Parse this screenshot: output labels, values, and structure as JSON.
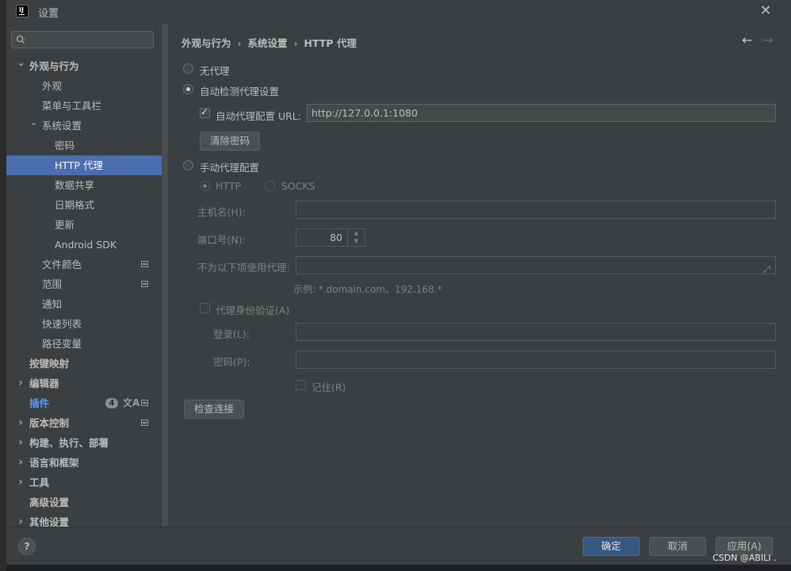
{
  "window": {
    "title": "设置",
    "app_logo": "IJ"
  },
  "search": {
    "placeholder": ""
  },
  "sidebar": {
    "items": [
      {
        "label": "外观与行为",
        "level": 0,
        "arrow": "down",
        "bold": true
      },
      {
        "label": "外观",
        "level": 1
      },
      {
        "label": "菜单与工具栏",
        "level": 1
      },
      {
        "label": "系统设置",
        "level": 1,
        "arrow": "down"
      },
      {
        "label": "密码",
        "level": 2
      },
      {
        "label": "HTTP 代理",
        "level": 2,
        "selected": true
      },
      {
        "label": "数据共享",
        "level": 2
      },
      {
        "label": "日期格式",
        "level": 2
      },
      {
        "label": "更新",
        "level": 2
      },
      {
        "label": "Android SDK",
        "level": 2
      },
      {
        "label": "文件颜色",
        "level": 1,
        "icon": "project-scope-icon"
      },
      {
        "label": "范围",
        "level": 1,
        "icon": "project-scope-icon"
      },
      {
        "label": "通知",
        "level": 1
      },
      {
        "label": "快速列表",
        "level": 1
      },
      {
        "label": "路径变量",
        "level": 1
      },
      {
        "label": "按键映射",
        "level": 0,
        "bold": true
      },
      {
        "label": "编辑器",
        "level": 0,
        "arrow": "right",
        "bold": true
      },
      {
        "label": "插件",
        "level": 0,
        "blue": true,
        "badge": "4",
        "icon": "project-scope-icon",
        "translate_icon": "文A"
      },
      {
        "label": "版本控制",
        "level": 0,
        "arrow": "right",
        "bold": true,
        "icon": "project-scope-icon"
      },
      {
        "label": "构建、执行、部署",
        "level": 0,
        "arrow": "right",
        "bold": true
      },
      {
        "label": "语言和框架",
        "level": 0,
        "arrow": "right",
        "bold": true
      },
      {
        "label": "工具",
        "level": 0,
        "arrow": "right",
        "bold": true
      },
      {
        "label": "高级设置",
        "level": 0,
        "bold": true
      },
      {
        "label": "其他设置",
        "level": 0,
        "arrow": "right",
        "bold": true
      }
    ]
  },
  "breadcrumb": {
    "items": [
      "外观与行为",
      "系统设置",
      "HTTP 代理"
    ],
    "separator": "›"
  },
  "nav": {
    "back": "←",
    "forward": "→"
  },
  "proxy": {
    "no_proxy_label": "无代理",
    "auto_detect_label": "自动检测代理设置",
    "auto_config_url_label": "自动代理配置 URL:",
    "auto_config_url_value": "http://127.0.0.1:1080",
    "clear_passwords_label": "清除密码",
    "manual_label": "手动代理配置",
    "http_label": "HTTP",
    "socks_label": "SOCKS",
    "host_label": "主机名(H):",
    "host_value": "",
    "port_label": "端口号(N):",
    "port_value": "80",
    "no_proxy_for_label": "不为以下项使用代理:",
    "no_proxy_for_value": "",
    "example_text": "示例: *.domain.com、192.168.*",
    "auth_label": "代理身份验证(A)",
    "login_label": "登录(L):",
    "login_value": "",
    "password_label": "密码(P):",
    "password_value": "",
    "remember_label": "记住(R)",
    "check_connection_label": "检查连接",
    "selected_mode": "auto_detect",
    "auto_config_checked": true,
    "auth_checked": false,
    "remember_checked": false
  },
  "footer": {
    "help_label": "?",
    "ok_label": "确定",
    "cancel_label": "取消",
    "apply_label": "应用(A)"
  },
  "watermark": "CSDN @ABILI .",
  "colors": {
    "accent": "#4b6eaf",
    "primary_button": "#365880",
    "link_blue": "#589df6",
    "background": "#3c3f41"
  }
}
